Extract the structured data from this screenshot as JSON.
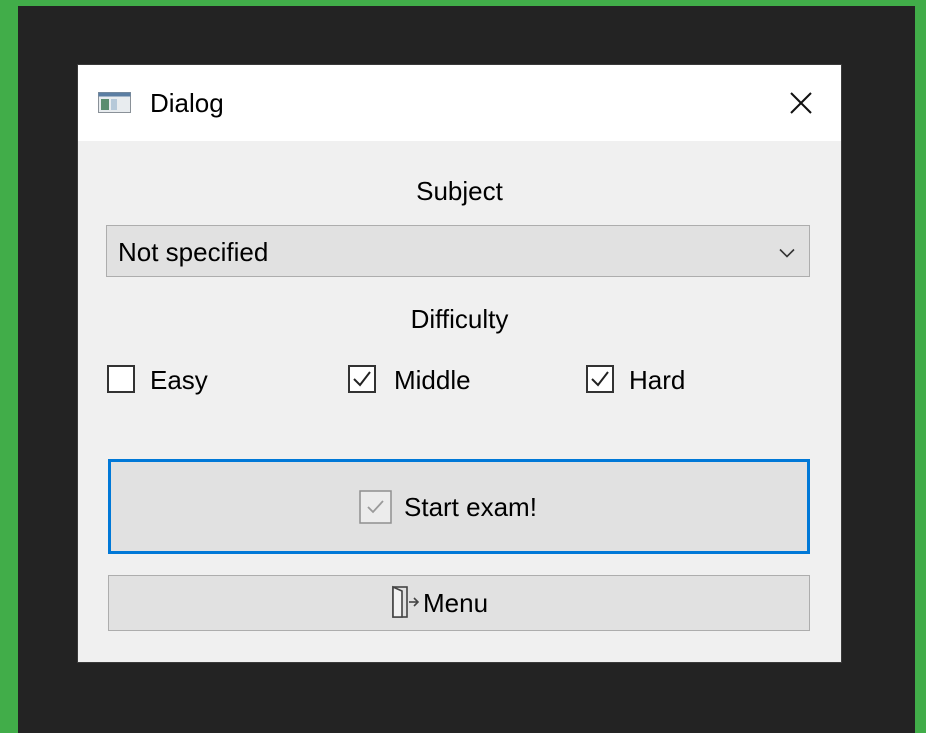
{
  "window": {
    "title": "Dialog",
    "icon": "window-app-icon",
    "close_icon": "close-icon"
  },
  "subject": {
    "label": "Subject",
    "selected": "Not specified",
    "arrow_icon": "chevron-down-icon"
  },
  "difficulty": {
    "label": "Difficulty",
    "options": [
      {
        "label": "Easy",
        "checked": false
      },
      {
        "label": "Middle",
        "checked": true
      },
      {
        "label": "Hard",
        "checked": true
      }
    ]
  },
  "actions": {
    "start_label": "Start exam!",
    "start_icon": "checkbox-check-icon",
    "menu_label": "Menu",
    "menu_icon": "door-exit-icon"
  },
  "colors": {
    "background_outer": "#41ad49",
    "background_inner": "#232323",
    "dialog_bg": "#f0f0f0",
    "focus_border": "#0078d7"
  }
}
